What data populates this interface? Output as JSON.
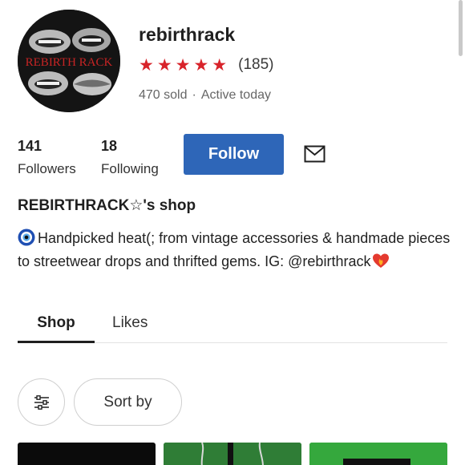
{
  "profile": {
    "username": "rebirthrack",
    "avatar_text": "REBIRTH RACK",
    "stars": "★★★★★",
    "review_count": "(185)",
    "sold": "470 sold",
    "separator": "·",
    "active": "Active today"
  },
  "stats": {
    "followers_count": "141",
    "followers_label": "Followers",
    "following_count": "18",
    "following_label": "Following"
  },
  "actions": {
    "follow_label": "Follow",
    "message_icon": "envelope-icon",
    "follow_color": "#2e66b8"
  },
  "shop": {
    "title": "REBIRTHRACK☆'s shop",
    "bio": "Handpicked heat(; from vintage accessories & handmade pieces to streetwear drops and thrifted gems. IG: @rebirthrack"
  },
  "tabs": [
    {
      "label": "Shop",
      "active": true
    },
    {
      "label": "Likes",
      "active": false
    }
  ],
  "controls": {
    "filter_icon": "sliders-icon",
    "sort_label": "Sort by"
  },
  "colors": {
    "stars": "#d8232a",
    "accent": "#2e66b8"
  }
}
